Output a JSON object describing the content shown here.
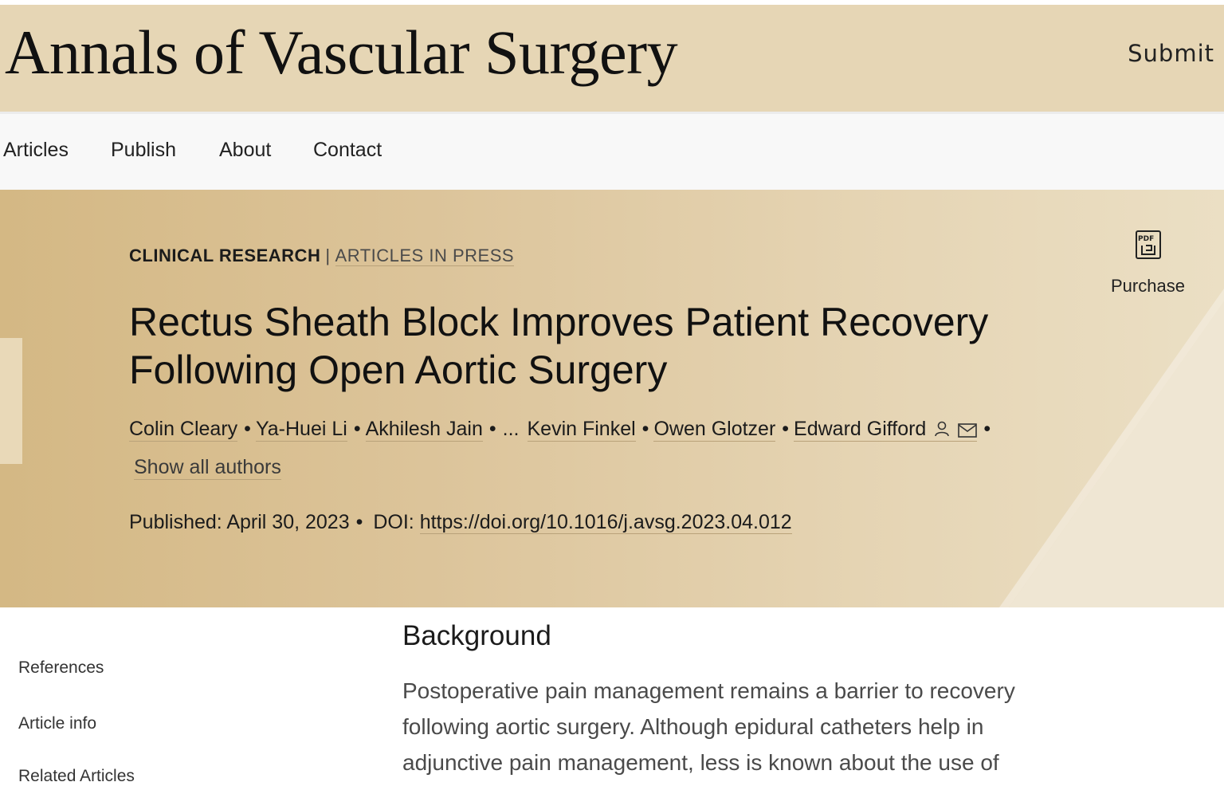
{
  "journal": {
    "title": "Annals of Vascular Surgery",
    "submit_label": "Submit"
  },
  "nav": {
    "items": [
      "Articles",
      "Publish",
      "About",
      "Contact"
    ]
  },
  "article": {
    "type": "CLINICAL RESEARCH",
    "separator": "|",
    "status": "ARTICLES IN PRESS",
    "title": "Rectus Sheath Block Improves Patient Recovery Following Open Aortic Surgery",
    "authors": [
      "Colin Cleary",
      "Ya-Huei Li",
      "Akhilesh Jain",
      "Kevin Finkel",
      "Owen Glotzer",
      "Edward Gifford"
    ],
    "ellipsis": "...",
    "show_all_label": "Show all authors",
    "published_label": "Published:",
    "published_date": "April 30, 2023",
    "doi_label": "DOI:",
    "doi": "https://doi.org/10.1016/j.avsg.2023.04.012"
  },
  "actions": {
    "pdf_icon": "pdf-icon",
    "purchase_label": "Purchase"
  },
  "sidebar": {
    "items": [
      "References",
      "Article info",
      "Related Articles"
    ]
  },
  "content": {
    "section_heading": "Background",
    "paragraph": "Postoperative pain management remains a barrier to recovery following aortic surgery. Although epidural catheters help in adjunctive pain management, less is known about the use of"
  },
  "colors": {
    "masthead_bg": "#e6d6b5",
    "hero_bg": "#d4b884",
    "link_underline": "#b9a27a"
  }
}
